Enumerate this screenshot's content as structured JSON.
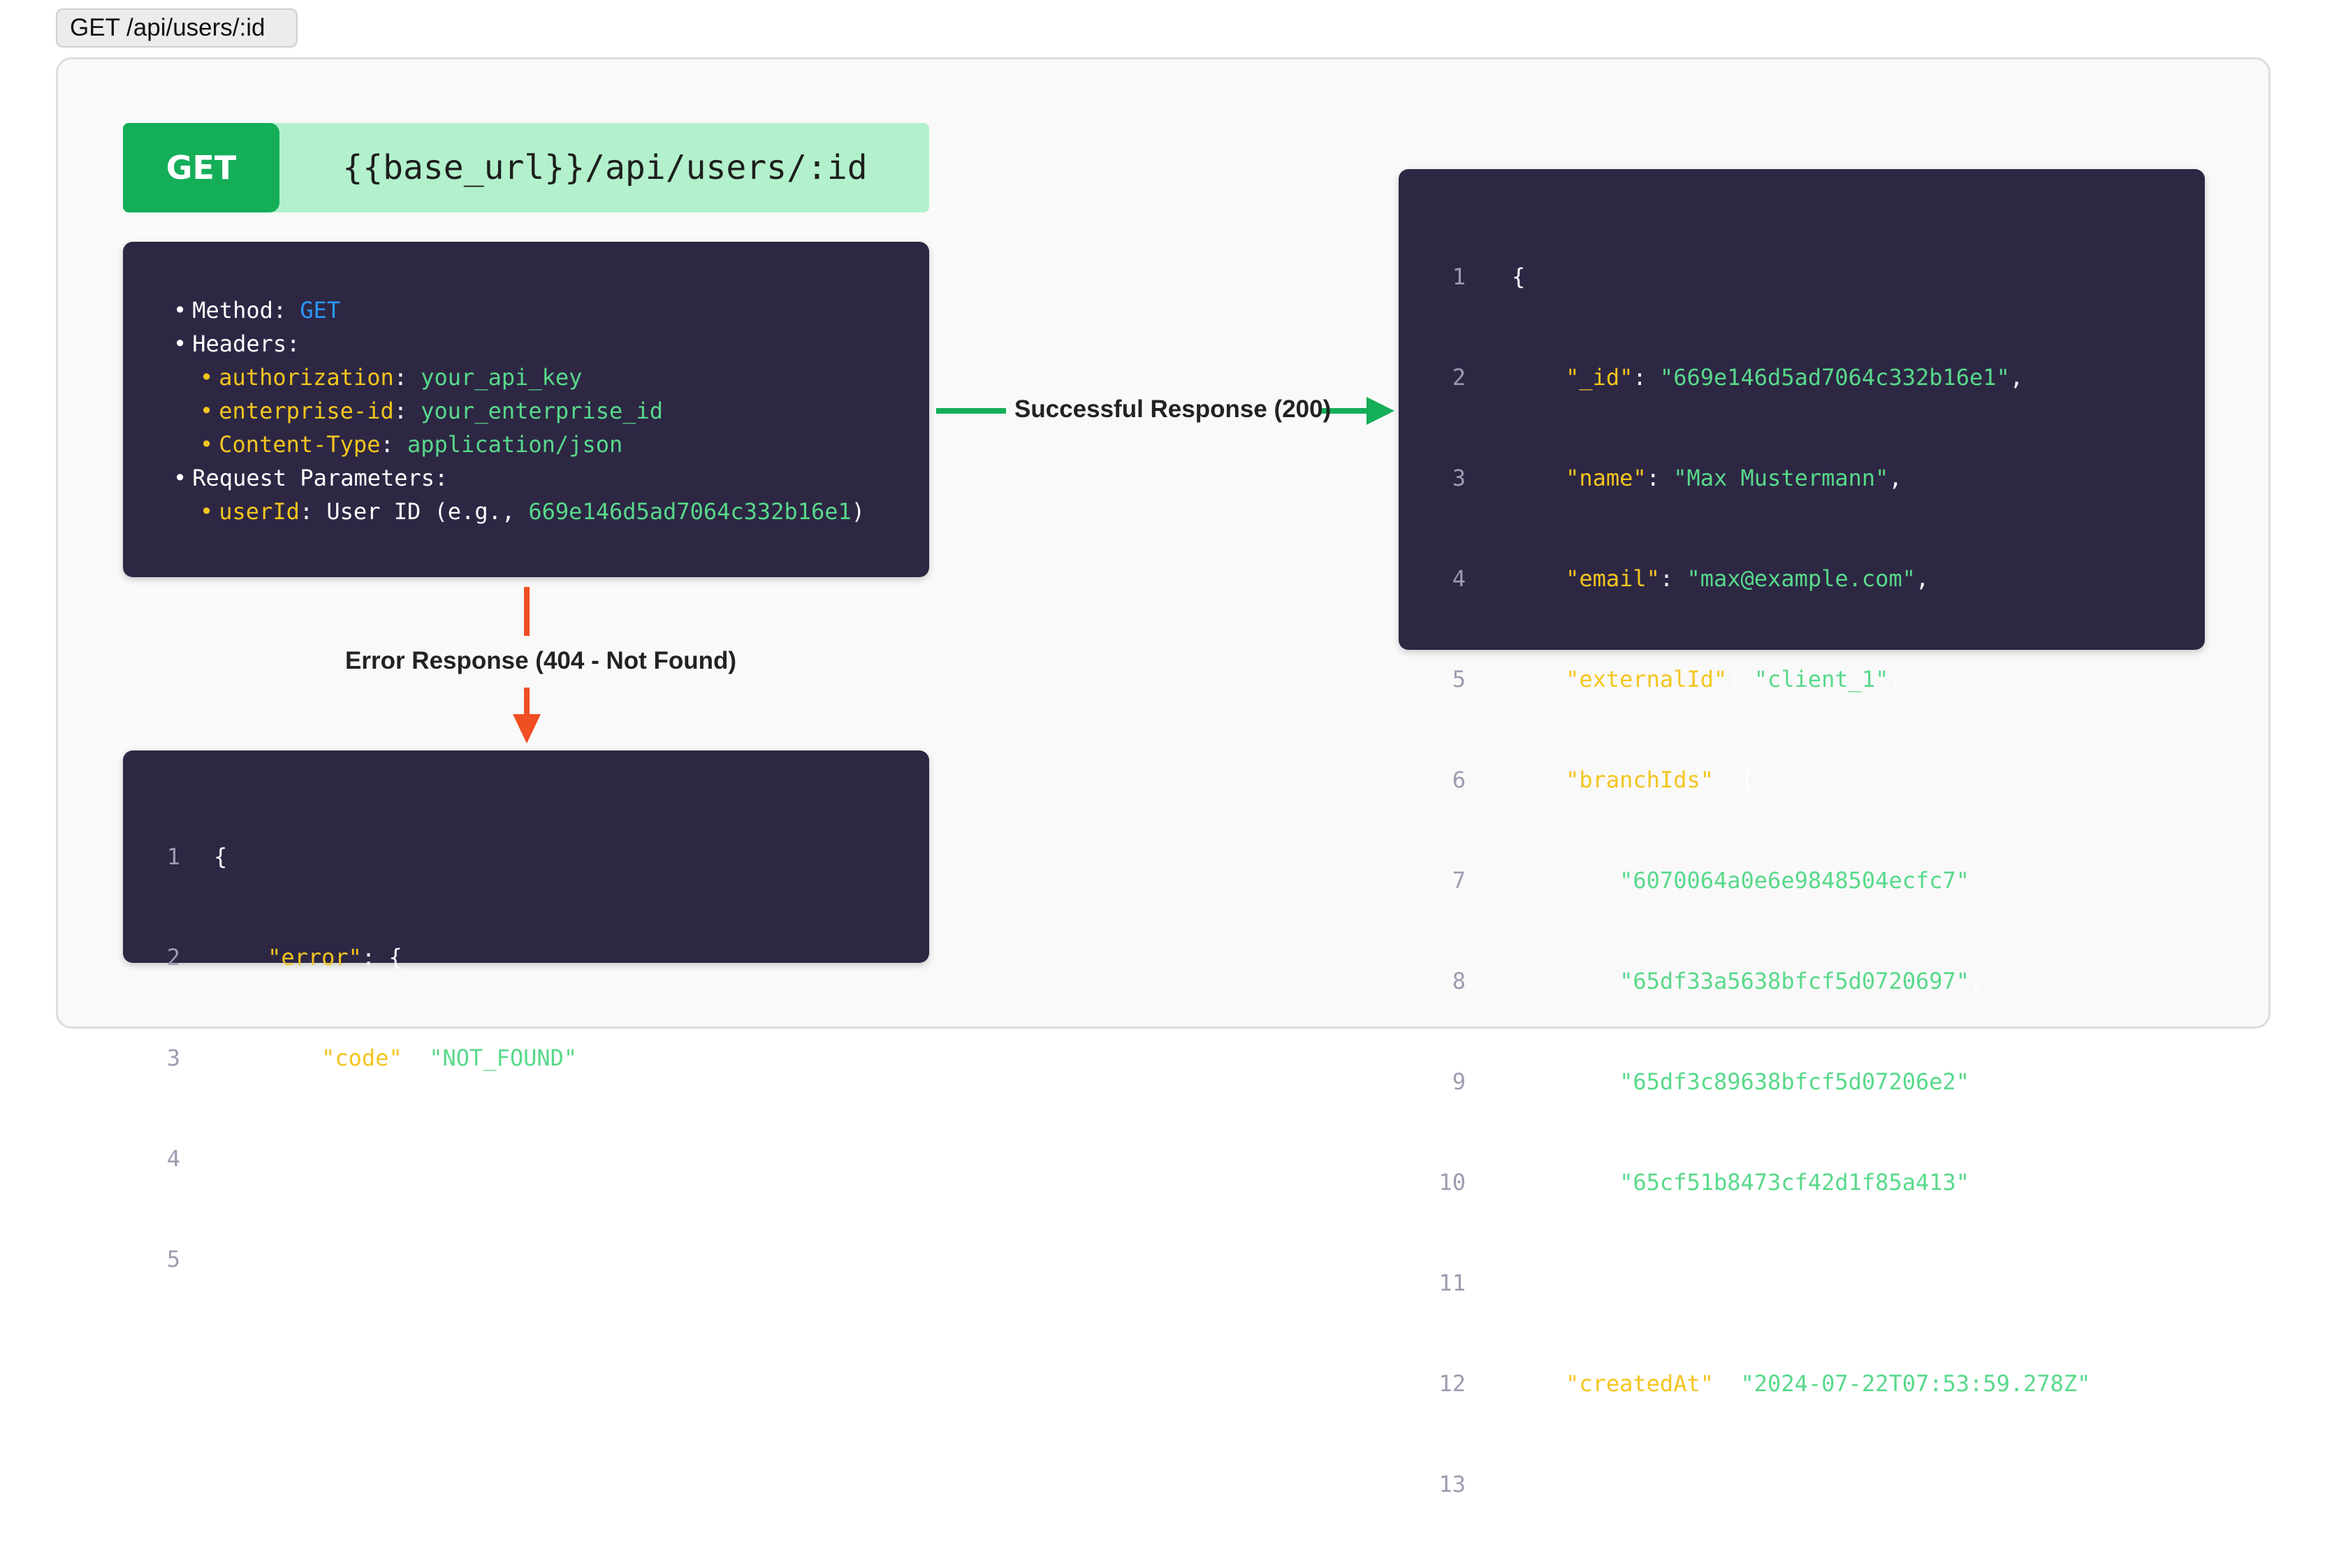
{
  "tab": {
    "label": "GET /api/users/:id"
  },
  "endpoint": {
    "method": "GET",
    "url": "{{base_url}}/api/users/:id"
  },
  "request": {
    "method_label": "Method:",
    "method_value": "GET",
    "headers_label": "Headers:",
    "headers": [
      {
        "key": "authorization",
        "value": "your_api_key"
      },
      {
        "key": "enterprise-id",
        "value": "your_enterprise_id"
      },
      {
        "key": "Content-Type",
        "value": "application/json"
      }
    ],
    "params_label": "Request Parameters:",
    "param_key": "userId",
    "param_desc": "User ID (e.g., ",
    "param_example": "669e146d5ad7064c332b16e1",
    "param_close": ")"
  },
  "success": {
    "label": "Successful Response (200)",
    "line_numbers": [
      "1",
      "2",
      "3",
      "4",
      "5",
      "6",
      "7",
      "8",
      "9",
      "10",
      "11",
      "12",
      "13"
    ],
    "id_key": "\"_id\"",
    "id_value": "\"669e146d5ad7064c332b16e1\"",
    "name_key": "\"name\"",
    "name_value": "\"Max Mustermann\"",
    "email_key": "\"email\"",
    "email_value": "\"max@example.com\"",
    "external_key": "\"externalId\"",
    "external_value": "\"client_1\"",
    "branch_key": "\"branchIds\"",
    "branch_ids": [
      "\"6070064a0e6e9848504ecfc7\"",
      "\"65df33a5638bfcf5d0720697\"",
      "\"65df3c89638bfcf5d07206e2\"",
      "\"65cf51b8473cf42d1f85a413\""
    ],
    "created_key": "\"createdAt\"",
    "created_value": "\"2024-07-22T07:53:59.278Z\""
  },
  "error": {
    "label": "Error Response (404 - Not Found)",
    "line_numbers": [
      "1",
      "2",
      "3",
      "4",
      "5"
    ],
    "error_key": "\"error\"",
    "code_key": "\"code\"",
    "code_value": "\"NOT_FOUND\""
  },
  "colors": {
    "method_green": "#14ae59",
    "url_bar": "#b2f1cb",
    "panel_bg": "#2d2744",
    "success_arrow": "#14ae59",
    "error_arrow": "#f04e23",
    "key_yellow": "#f4c51f",
    "string_green": "#58d98a",
    "method_blue": "#2a97ff"
  }
}
